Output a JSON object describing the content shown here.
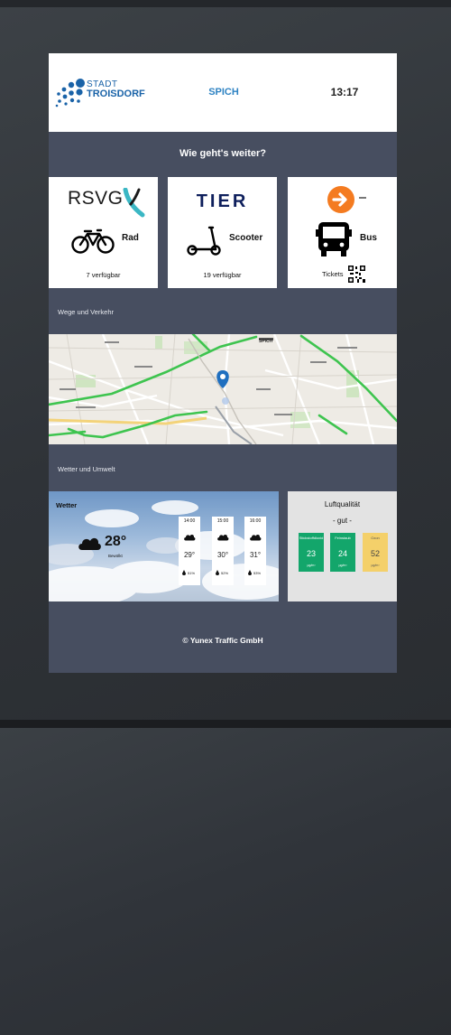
{
  "header": {
    "logo_line1": "STADT",
    "logo_line2": "TROISDORF",
    "location": "SPICH",
    "time": "13:17"
  },
  "headline": "Wie geht's weiter?",
  "tiles": [
    {
      "brand": "RSVG",
      "label": "Rad",
      "count": "7 verfügbar",
      "icon": "bicycle-icon"
    },
    {
      "brand": "TIER",
      "label": "Scooter",
      "count": "19 verfügbar",
      "icon": "scooter-icon"
    },
    {
      "label": "Bus",
      "count": "Tickets",
      "icon": "bus-icon"
    }
  ],
  "sections": {
    "traffic": "Wege und Verkehr",
    "weather": "Wetter und Umwelt"
  },
  "map": {
    "place_label": "SPICH"
  },
  "weather": {
    "title": "Wetter",
    "current_temp": "28°",
    "condition": "Bewölkt",
    "forecast": [
      {
        "time": "14:00",
        "temp": "29°",
        "precip": "51%"
      },
      {
        "time": "15:00",
        "temp": "30°",
        "precip": "52%"
      },
      {
        "time": "16:00",
        "temp": "31°",
        "precip": "53%"
      }
    ]
  },
  "air_quality": {
    "title": "Luftqualität",
    "status": "- gut -",
    "items": [
      {
        "name": "Stickstoffdioxid",
        "value": "23",
        "unit": "µg/m³",
        "color": "#13a66b"
      },
      {
        "name": "Feinstaub",
        "value": "24",
        "unit": "µg/m³",
        "color": "#13a66b"
      },
      {
        "name": "Ozon",
        "value": "52",
        "unit": "µg/m³",
        "color": "#f4d06a"
      }
    ]
  },
  "colors": {
    "screen_bg": "#474e60",
    "accent_blue": "#1a63a8",
    "tier_navy": "#0e1f5c",
    "orange": "#f47b20"
  },
  "footer": "© Yunex Traffic GmbH"
}
